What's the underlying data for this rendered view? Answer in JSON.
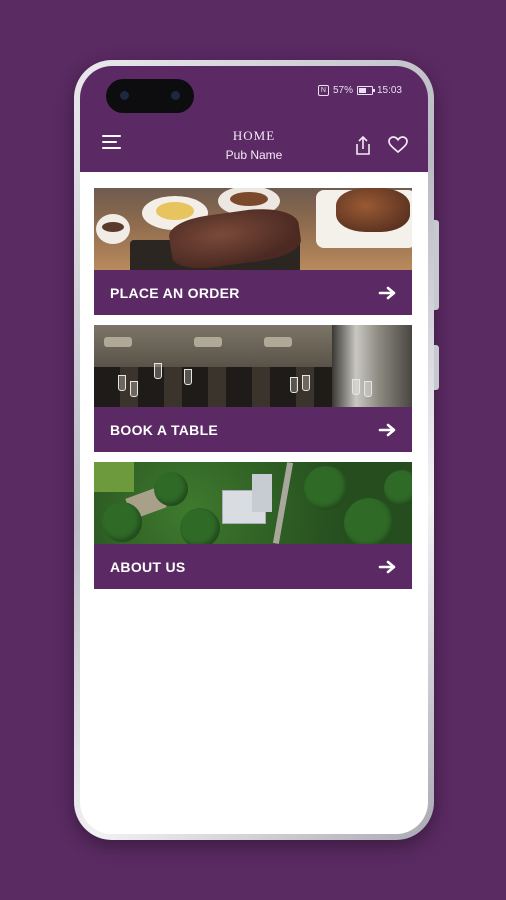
{
  "status_bar": {
    "nfc_icon": "nfc-icon",
    "battery_percent": "57%",
    "time": "15:03"
  },
  "header": {
    "title": "HOME",
    "subtitle": "Pub Name",
    "menu_icon": "hamburger-menu-icon",
    "share_icon": "share-icon",
    "favorite_icon": "heart-icon"
  },
  "cards": [
    {
      "label": "PLACE AN ORDER",
      "image": "steak-dinner-photo",
      "icon": "arrow-right-icon"
    },
    {
      "label": "BOOK A TABLE",
      "image": "restaurant-interior-photo",
      "icon": "arrow-right-icon"
    },
    {
      "label": "ABOUT US",
      "image": "aerial-estate-photo",
      "icon": "arrow-right-icon"
    }
  ],
  "colors": {
    "brand_purple": "#5b2a64",
    "background": "#5a2a62",
    "text_light": "#ffffff"
  }
}
